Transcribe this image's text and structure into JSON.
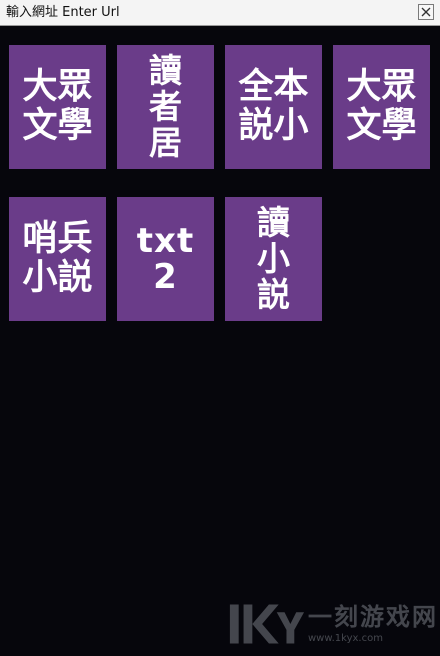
{
  "url_bar": {
    "placeholder": "輸入網址 Enter Url",
    "close_icon": "close-icon"
  },
  "tiles": [
    {
      "lines": [
        "大眾",
        "文學"
      ]
    },
    {
      "lines": [
        "讀",
        "者",
        "居"
      ]
    },
    {
      "lines": [
        "全本",
        "説小"
      ]
    },
    {
      "lines": [
        "大眾",
        "文學"
      ]
    },
    {
      "lines": [
        "哨兵",
        "小説"
      ]
    },
    {
      "lines": [
        "txt",
        "2"
      ]
    },
    {
      "lines": [
        "讀",
        "小",
        "説"
      ]
    }
  ],
  "watermark": {
    "name": "一刻游戏网",
    "url": "www.1kyx.com"
  },
  "colors": {
    "background": "#06060c",
    "tile": "#6a3c89",
    "tile_text": "#ffffff",
    "url_bar": "#f4f4f4"
  }
}
